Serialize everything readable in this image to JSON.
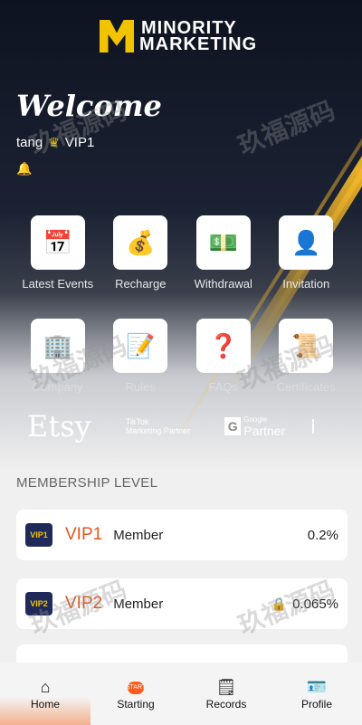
{
  "brand": {
    "line1": "MINORITY",
    "line2": "MARKETING"
  },
  "welcome": "Welcome",
  "user": {
    "name": "tang",
    "level": "VIP1"
  },
  "menu": [
    {
      "label": "Latest Events",
      "icon": "calendar-icon"
    },
    {
      "label": "Recharge",
      "icon": "money-bag-icon"
    },
    {
      "label": "Withdrawal",
      "icon": "cash-icon"
    },
    {
      "label": "Invitation",
      "icon": "add-user-icon"
    },
    {
      "label": "Company",
      "icon": "building-icon"
    },
    {
      "label": "Rules",
      "icon": "document-icon"
    },
    {
      "label": "FAQs",
      "icon": "faq-icon"
    },
    {
      "label": "Certificates",
      "icon": "certificate-icon"
    }
  ],
  "partners": {
    "etsy": "Etsy",
    "tiktok_line1": "TikTok",
    "tiktok_line2": "Marketing Partner",
    "google_box": "G",
    "google_top": "Google",
    "google_bottom": "Partner"
  },
  "membership": {
    "title": "MEMBERSHIP LEVEL",
    "levels": [
      {
        "badge": "VIP1",
        "name": "VIP1",
        "role": "Member",
        "rate": "0.2%"
      },
      {
        "badge": "VIP2",
        "name": "VIP2",
        "role": "Member",
        "rate": "0.065%",
        "locked": true
      }
    ]
  },
  "watermark": "玖福源码",
  "nav": [
    {
      "label": "Home",
      "icon": "home-icon"
    },
    {
      "label": "Starting",
      "icon": "starting-icon",
      "icon_text": "START"
    },
    {
      "label": "Records",
      "icon": "records-icon"
    },
    {
      "label": "Profile",
      "icon": "profile-icon"
    }
  ],
  "colors": {
    "accent": "#e0561c",
    "gold": "#f2c300",
    "alert": "#e02424"
  }
}
